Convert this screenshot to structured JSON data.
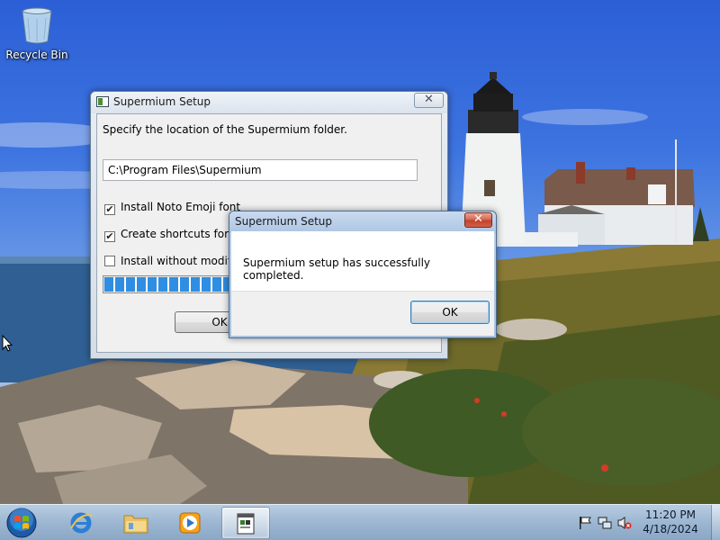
{
  "desktop": {
    "icons": [
      {
        "label": "Recycle Bin",
        "icon": "recycle-bin-icon"
      }
    ]
  },
  "setup_window": {
    "title": "Supermium Setup",
    "close_symbol": "✕",
    "prompt": "Specify the location of the Supermium folder.",
    "install_path": "C:\\Program Files\\Supermium",
    "options": [
      {
        "label": "Install Noto Emoji font",
        "checked": true
      },
      {
        "label": "Create shortcuts for S",
        "checked": true
      },
      {
        "label": "Install without modifyi",
        "checked": false
      }
    ],
    "progress_fraction": 0.4,
    "ok_label": "OK"
  },
  "completion_dialog": {
    "title": "Supermium Setup",
    "close_symbol": "✕",
    "message": "Supermium setup has successfully completed.",
    "ok_label": "OK"
  },
  "taskbar": {
    "start_icon": "windows-start-orb-icon",
    "items": [
      {
        "name": "internet-explorer",
        "icon": "internet-explorer-icon",
        "active": false
      },
      {
        "name": "file-explorer",
        "icon": "folder-icon",
        "active": false
      },
      {
        "name": "media-player",
        "icon": "media-player-icon",
        "active": false
      },
      {
        "name": "supermium-setup",
        "icon": "setup-window-icon",
        "active": true
      }
    ],
    "tray_icons": [
      "action-center-flag-icon",
      "network-icon",
      "volume-muted-icon"
    ],
    "clock": {
      "time": "11:20 PM",
      "date": "4/18/2024"
    }
  },
  "colors": {
    "progress": "#2f8ee2",
    "taskbar": "#9fb8d3",
    "dialog_frame": "#adc5e3",
    "close_red": "#c1402a"
  }
}
